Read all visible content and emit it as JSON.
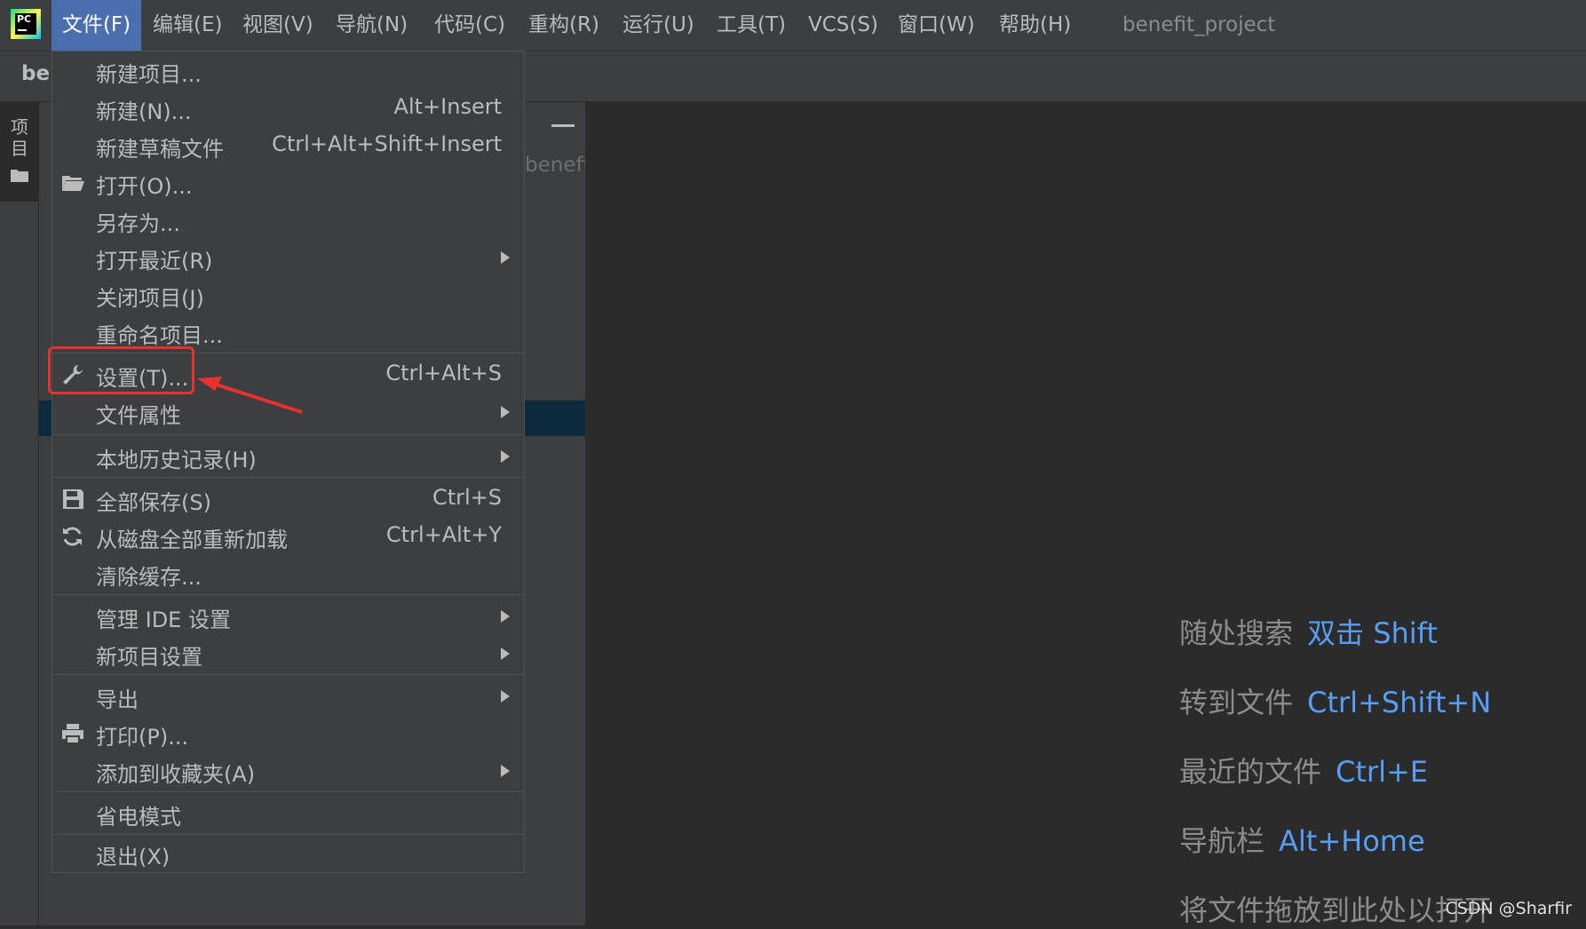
{
  "menubar": {
    "items": [
      {
        "label": "文件(F)"
      },
      {
        "label": "编辑(E)"
      },
      {
        "label": "视图(V)"
      },
      {
        "label": "导航(N)"
      },
      {
        "label": "代码(C)"
      },
      {
        "label": "重构(R)"
      },
      {
        "label": "运行(U)"
      },
      {
        "label": "工具(T)"
      },
      {
        "label": "VCS(S)"
      },
      {
        "label": "窗口(W)"
      },
      {
        "label": "帮助(H)"
      }
    ],
    "project_title": "benefit_project",
    "app_icon": "pycharm-logo",
    "app_icon_text": "PC"
  },
  "navbar": {
    "breadcrumb": "ber"
  },
  "toolstrip": {
    "project_tab_label": "项目"
  },
  "project_panel": {
    "tree_text": "benefi"
  },
  "file_menu": {
    "items": [
      {
        "label": "新建项目...",
        "shortcut": "",
        "submenu": false,
        "icon": ""
      },
      {
        "label": "新建(N)...",
        "shortcut": "Alt+Insert",
        "submenu": false,
        "icon": ""
      },
      {
        "label": "新建草稿文件",
        "shortcut": "Ctrl+Alt+Shift+Insert",
        "submenu": false,
        "icon": ""
      },
      {
        "label": "打开(O)...",
        "shortcut": "",
        "submenu": false,
        "icon": "folder-open-icon"
      },
      {
        "label": "另存为...",
        "shortcut": "",
        "submenu": false,
        "icon": ""
      },
      {
        "label": "打开最近(R)",
        "shortcut": "",
        "submenu": true,
        "icon": ""
      },
      {
        "label": "关闭项目(J)",
        "shortcut": "",
        "submenu": false,
        "icon": ""
      },
      {
        "label": "重命名项目...",
        "shortcut": "",
        "submenu": false,
        "icon": ""
      },
      {
        "label": "设置(T)...",
        "shortcut": "Ctrl+Alt+S",
        "submenu": false,
        "icon": "wrench-icon"
      },
      {
        "label": "文件属性",
        "shortcut": "",
        "submenu": true,
        "icon": ""
      },
      {
        "label": "本地历史记录(H)",
        "shortcut": "",
        "submenu": true,
        "icon": ""
      },
      {
        "label": "全部保存(S)",
        "shortcut": "Ctrl+S",
        "submenu": false,
        "icon": "save-icon"
      },
      {
        "label": "从磁盘全部重新加载",
        "shortcut": "Ctrl+Alt+Y",
        "submenu": false,
        "icon": "reload-icon"
      },
      {
        "label": "清除缓存...",
        "shortcut": "",
        "submenu": false,
        "icon": ""
      },
      {
        "label": "管理 IDE 设置",
        "shortcut": "",
        "submenu": true,
        "icon": ""
      },
      {
        "label": "新项目设置",
        "shortcut": "",
        "submenu": true,
        "icon": ""
      },
      {
        "label": "导出",
        "shortcut": "",
        "submenu": true,
        "icon": ""
      },
      {
        "label": "打印(P)...",
        "shortcut": "",
        "submenu": false,
        "icon": "print-icon"
      },
      {
        "label": "添加到收藏夹(A)",
        "shortcut": "",
        "submenu": true,
        "icon": ""
      },
      {
        "label": "省电模式",
        "shortcut": "",
        "submenu": false,
        "icon": ""
      },
      {
        "label": "退出(X)",
        "shortcut": "",
        "submenu": false,
        "icon": ""
      }
    ]
  },
  "editor_hints": [
    {
      "text": "随处搜索",
      "shortcut": "双击 Shift"
    },
    {
      "text": "转到文件",
      "shortcut": "Ctrl+Shift+N"
    },
    {
      "text": "最近的文件",
      "shortcut": "Ctrl+E"
    },
    {
      "text": "导航栏",
      "shortcut": "Alt+Home"
    },
    {
      "text": "将文件拖放到此处以打开",
      "shortcut": ""
    }
  ],
  "watermark": "CSDN @Sharfir",
  "colors": {
    "menu_active": "#4b6eaf",
    "hint_shortcut": "#589df6",
    "annotation": "#e8322b"
  }
}
